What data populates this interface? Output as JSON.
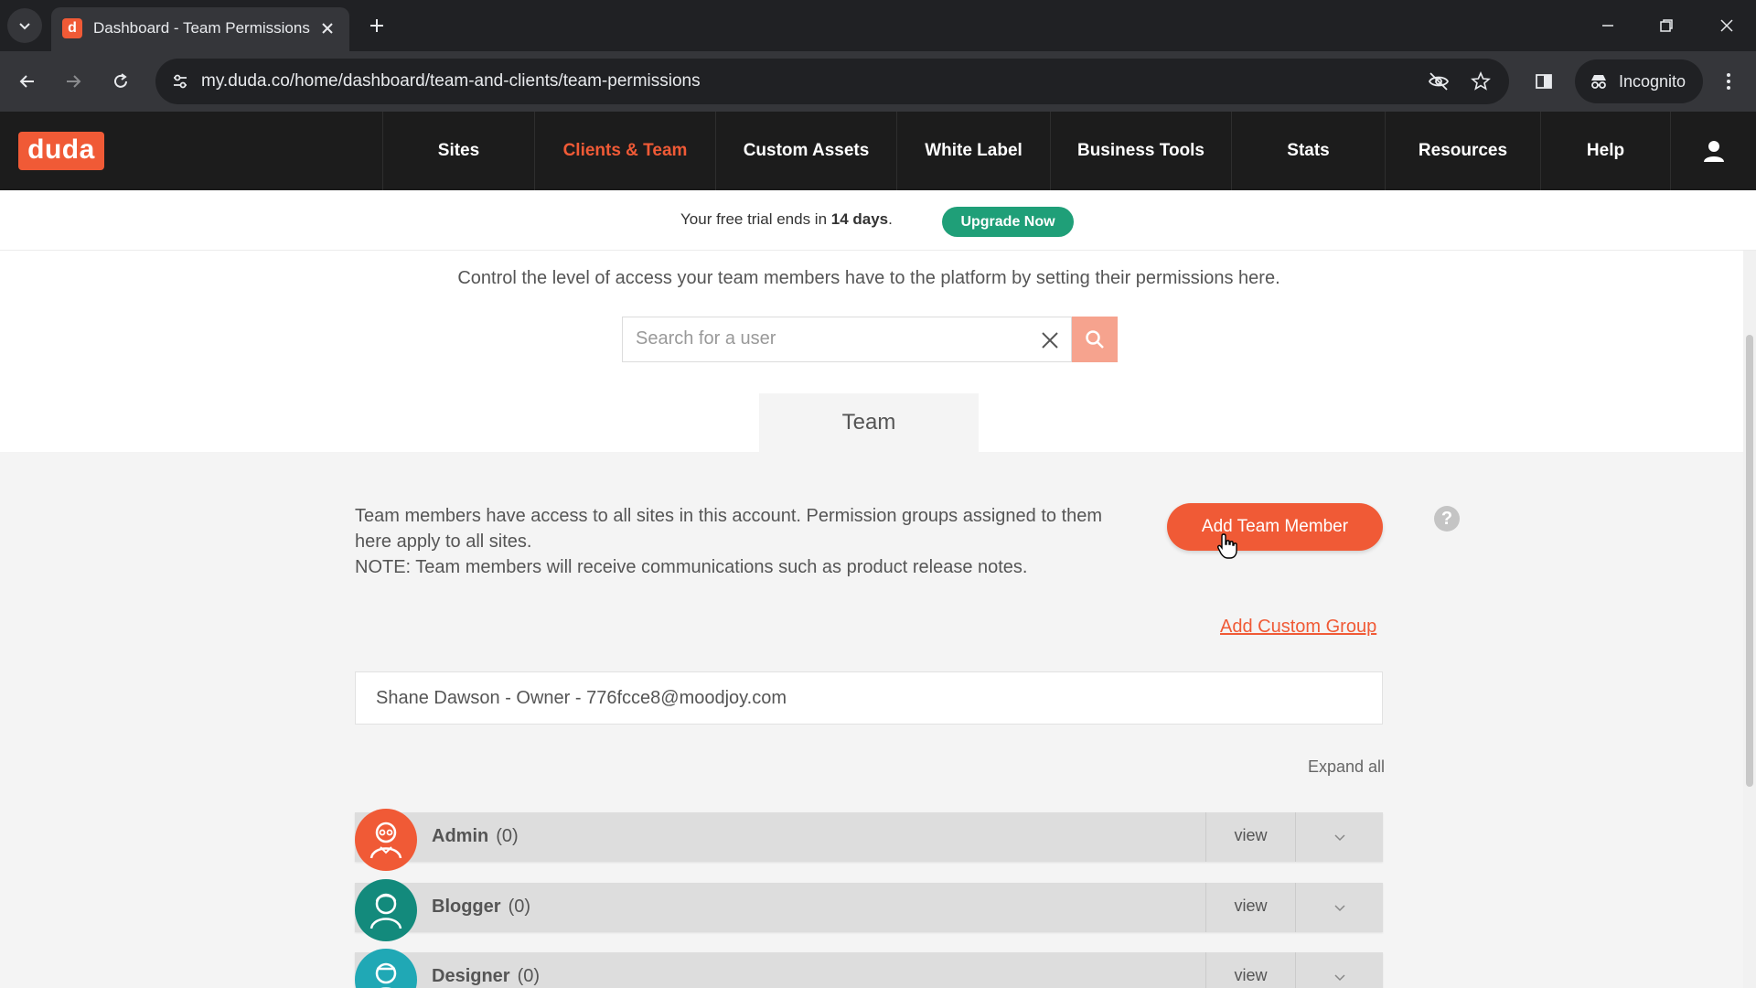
{
  "browser": {
    "tab_title": "Dashboard - Team Permissions",
    "url": "my.duda.co/home/dashboard/team-and-clients/team-permissions",
    "incognito_label": "Incognito"
  },
  "header": {
    "logo": "duda",
    "nav": [
      "Sites",
      "Clients & Team",
      "Custom Assets",
      "White Label",
      "Business Tools",
      "Stats",
      "Resources",
      "Help"
    ],
    "active_nav": "Clients & Team"
  },
  "trial": {
    "text_before": "Your free trial ends in ",
    "days": "14 days",
    "text_after": ".",
    "upgrade_label": "Upgrade Now"
  },
  "page": {
    "intro": "Control the level of access your team members have to the platform by setting their permissions here.",
    "search_placeholder": "Search for a user",
    "tab_label": "Team",
    "description_line1": "Team members have access to all sites in this account. Permission groups assigned to them here apply to all sites.",
    "description_line2": "NOTE: Team members will receive communications such as product release notes.",
    "add_member_label": "Add Team Member",
    "help_label": "?",
    "add_group_label": "Add Custom Group",
    "owner_entry": "Shane Dawson - Owner - 776fcce8@moodjoy.com",
    "expand_all_label": "Expand all",
    "groups": [
      {
        "name": "Admin",
        "count": "(0)",
        "view": "view",
        "color": "#f05a36"
      },
      {
        "name": "Blogger",
        "count": "(0)",
        "view": "view",
        "color": "#138a7c"
      },
      {
        "name": "Designer",
        "count": "(0)",
        "view": "view",
        "color": "#20a8b5"
      }
    ]
  },
  "colors": {
    "brand": "#f05a36",
    "upgrade": "#1f9f78",
    "header_bg": "#1c1c1c"
  }
}
